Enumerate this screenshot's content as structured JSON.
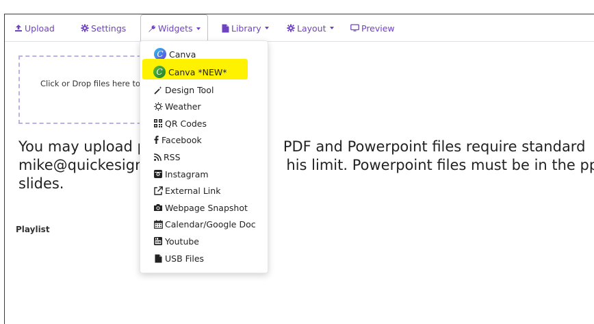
{
  "tabs": [
    {
      "label": "Upload",
      "icon": "upload-icon"
    },
    {
      "label": "Settings",
      "icon": "gear-icon"
    },
    {
      "label": "Widgets",
      "icon": "wrench-icon"
    },
    {
      "label": "Library",
      "icon": "file-icon"
    },
    {
      "label": "Layout",
      "icon": "gear-icon"
    },
    {
      "label": "Preview",
      "icon": "monitor-icon"
    }
  ],
  "dropzone_text": "Click or Drop files here to",
  "info_lines": [
    "You may upload p",
    "mike@quickesign",
    "slides."
  ],
  "info_right_lines": [
    "PDF and Powerpoint files require standard",
    "his limit. Powerpoint files must be in the ppt"
  ],
  "playlist_label": "Playlist",
  "widgets_menu": [
    {
      "label": "Canva",
      "icon": "canva-logo-icon"
    },
    {
      "label": "Canva *NEW*",
      "icon": "canva-new-logo-icon"
    },
    {
      "label": "Design Tool",
      "icon": "magic-wand-icon"
    },
    {
      "label": "Weather",
      "icon": "sun-icon"
    },
    {
      "label": "QR Codes",
      "icon": "qr-code-icon"
    },
    {
      "label": "Facebook",
      "icon": "facebook-icon"
    },
    {
      "label": "RSS",
      "icon": "rss-icon"
    },
    {
      "label": "Instagram",
      "icon": "instagram-icon"
    },
    {
      "label": "External Link",
      "icon": "external-link-icon"
    },
    {
      "label": "Webpage Snapshot",
      "icon": "camera-icon"
    },
    {
      "label": "Calendar/Google Doc",
      "icon": "calendar-icon"
    },
    {
      "label": "Youtube",
      "icon": "youtube-icon"
    },
    {
      "label": "USB Files",
      "icon": "file-icon"
    }
  ],
  "colors": {
    "accent": "#6f42c1",
    "highlight": "#fff200",
    "dropzone_border": "#b9b2e6"
  }
}
